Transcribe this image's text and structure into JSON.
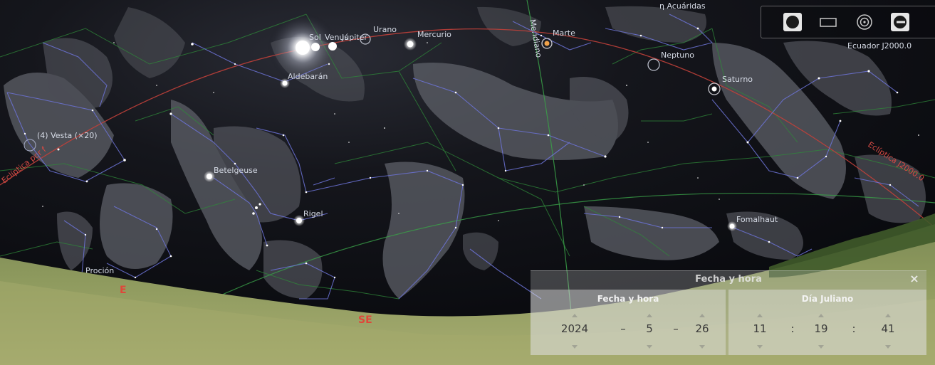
{
  "sky": {
    "objects": {
      "sol": "Sol",
      "venus": "Venus",
      "jupiter": "Júpiter",
      "urano": "Urano",
      "mercurio": "Mercurio",
      "marte": "Marte",
      "neptuno": "Neptuno",
      "saturno": "Saturno",
      "aldebaran": "Aldebarán",
      "vesta": "(4) Vesta (×20)",
      "betelgeuse": "Betelgeuse",
      "rigel": "Rigel",
      "procion": "Proción",
      "fomalhaut": "Fomalhaut",
      "acuaridas": "η Acuáridas"
    },
    "lines": {
      "ecliptica_left": "Eclíptica por f",
      "ecliptica_right": "Eclíptica J2000.0",
      "ecuador": "Ecuador J2000.0",
      "meridiano": "Meridiano"
    },
    "cardinals": {
      "east": "E",
      "southeast": "SE"
    }
  },
  "toolbar": {
    "buttons": [
      "planet-icon",
      "rectangle-icon",
      "target-icon",
      "key-icon"
    ]
  },
  "datetime_window": {
    "title": "Fecha y hora",
    "close": "×",
    "tab_date": "Fecha y hora",
    "tab_jd": "Día Juliano",
    "year": "2024",
    "month": "5",
    "day": "26",
    "hour": "11",
    "minute": "19",
    "second": "41",
    "date_sep": "–",
    "time_sep": ":"
  }
}
